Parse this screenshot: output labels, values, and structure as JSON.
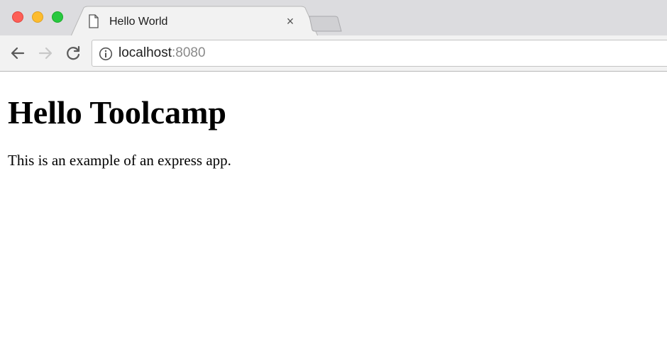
{
  "window": {
    "buttons": [
      "close",
      "minimize",
      "maximize"
    ]
  },
  "tabs": [
    {
      "title": "Hello World",
      "icon": "document-icon",
      "active": true,
      "close_label": "×"
    }
  ],
  "toolbar": {
    "back_icon": "arrow-left-icon",
    "forward_icon": "arrow-right-icon",
    "reload_icon": "reload-icon",
    "forward_enabled": false
  },
  "address_bar": {
    "icon": "info-icon",
    "host": "localhost",
    "port": ":8080"
  },
  "page": {
    "heading": "Hello Toolcamp",
    "paragraph": "This is an example of an express app."
  },
  "colors": {
    "titlebar_bg": "#dcdcdf",
    "toolbar_bg": "#f2f2f2",
    "traffic_close": "#fd5f57",
    "traffic_minimize": "#fdbc2e",
    "traffic_maximize": "#28c840"
  }
}
